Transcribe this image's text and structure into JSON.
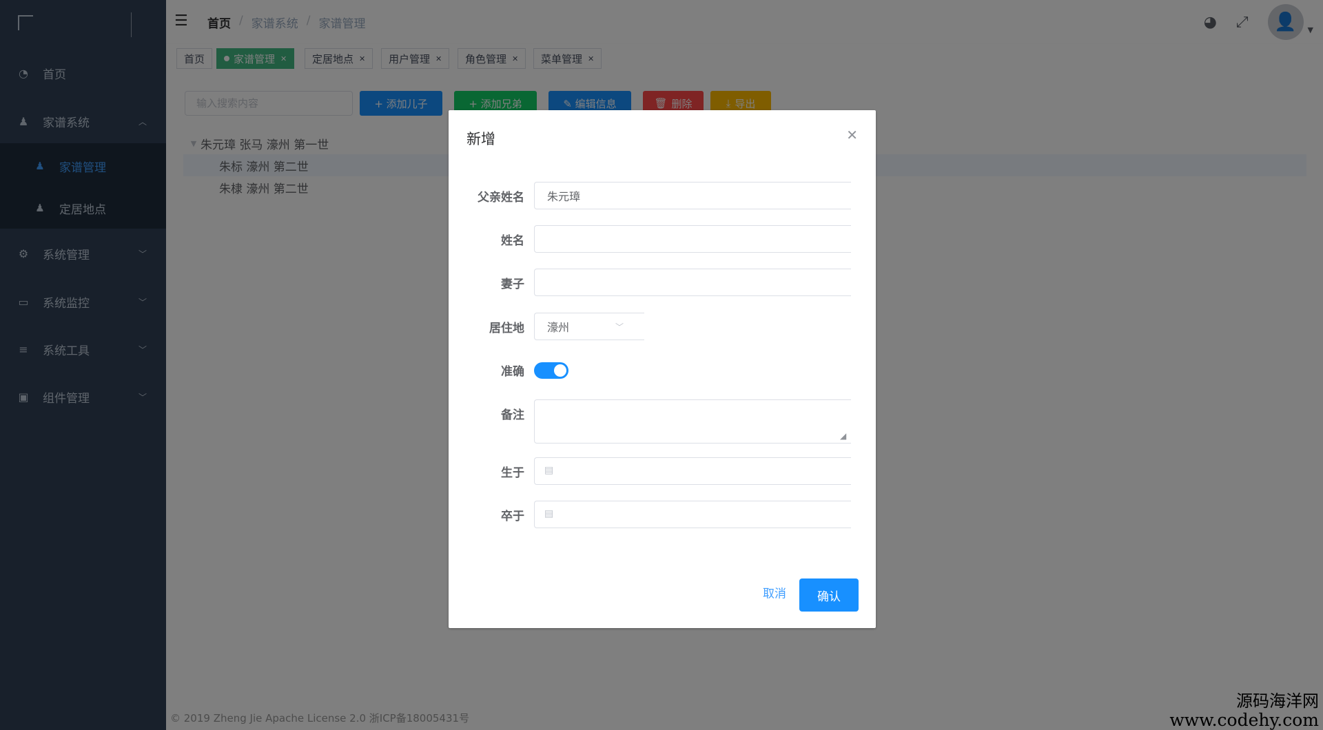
{
  "sidebar": {
    "menu": [
      {
        "label": "首页",
        "icon": "dashboard-icon"
      },
      {
        "label": "家谱系统",
        "icon": "user-icon",
        "expanded": true
      },
      {
        "label": "系统管理",
        "icon": "gear-icon"
      },
      {
        "label": "系统监控",
        "icon": "monitor-icon"
      },
      {
        "label": "系统工具",
        "icon": "tool-icon"
      },
      {
        "label": "组件管理",
        "icon": "component-icon"
      }
    ],
    "submenu": [
      {
        "label": "家谱管理",
        "icon": "user-icon",
        "active": true
      },
      {
        "label": "定居地点",
        "icon": "user-icon"
      }
    ]
  },
  "navbar": {
    "breadcrumb": [
      "首页",
      "/",
      "家谱系统",
      "/",
      "家谱管理"
    ]
  },
  "tags": [
    {
      "label": "首页"
    },
    {
      "label": "家谱管理",
      "active": true
    },
    {
      "label": "定居地点"
    },
    {
      "label": "用户管理"
    },
    {
      "label": "角色管理"
    },
    {
      "label": "菜单管理"
    }
  ],
  "toolbar": {
    "search_placeholder": "输入搜索内容",
    "add_child": "+ 添加儿子",
    "add_sibling": "+ 添加兄弟",
    "edit": "✎ 编辑信息",
    "delete": "删除",
    "export": "导出",
    "colors": {
      "primary": "#1890ff",
      "success": "#13ce66",
      "danger": "#ff4949",
      "warning": "#ffba00"
    }
  },
  "tree": [
    {
      "label": "朱元璋 张马 濠州 第一世",
      "level": 1,
      "expanded": true
    },
    {
      "label": "朱标 濠州 第二世",
      "level": 2,
      "selected": true
    },
    {
      "label": "朱棣 濠州 第二世",
      "level": 2
    }
  ],
  "footer": {
    "text": "© 2019 Zheng Jie Apache License 2.0  浙ICP备18005431号"
  },
  "watermark": {
    "line1": "源码海洋网",
    "line2": "www.codehy.com"
  },
  "dialog": {
    "title": "新增",
    "fields": {
      "father_name": {
        "label": "父亲姓名",
        "value": "朱元璋"
      },
      "name": {
        "label": "姓名",
        "value": ""
      },
      "wife": {
        "label": "妻子",
        "value": ""
      },
      "residence": {
        "label": "居住地",
        "value": "濠州"
      },
      "accurate": {
        "label": "准确",
        "on": true
      },
      "remark": {
        "label": "备注",
        "value": ""
      },
      "born": {
        "label": "生于",
        "value": ""
      },
      "died": {
        "label": "卒于",
        "value": ""
      }
    },
    "cancel": "取消",
    "confirm": "确认"
  }
}
